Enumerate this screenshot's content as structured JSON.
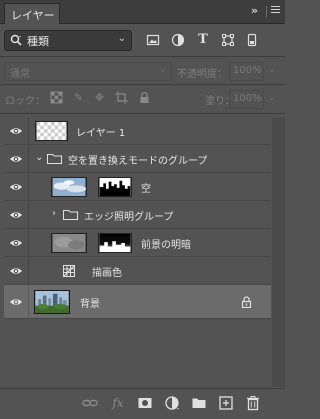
{
  "panel": {
    "tab_title": "レイヤー",
    "tab_close": "×",
    "collapse": "»"
  },
  "filter": {
    "kind_label": "種類",
    "icons": [
      "image-filter-icon",
      "adjustment-filter-icon",
      "type-filter-icon",
      "shape-filter-icon",
      "smart-object-filter-icon"
    ]
  },
  "blend": {
    "mode": "通常",
    "opacity_label": "不透明度：",
    "opacity_value": "100%"
  },
  "lock": {
    "label": "ロック：",
    "fill_label": "塗り：",
    "fill_value": "100%"
  },
  "layers": [
    {
      "name": "レイヤー 1",
      "type": "pixel",
      "visible": true,
      "selected": false
    },
    {
      "name": "空を置き換えモードのグループ",
      "type": "group",
      "expanded": true,
      "visible": true
    },
    {
      "name": "空",
      "type": "pixel-with-mask",
      "visible": true
    },
    {
      "name": "エッジ照明グループ",
      "type": "group",
      "expanded": false,
      "visible": true
    },
    {
      "name": "前景の明暗",
      "type": "pixel-with-mask",
      "visible": true
    },
    {
      "name": "描画色",
      "type": "adjustment",
      "visible": true
    },
    {
      "name": "背景",
      "type": "background",
      "visible": true,
      "selected": true,
      "locked": true
    }
  ],
  "footer": {
    "icons": [
      "link-layers-icon",
      "fx-icon",
      "add-mask-icon",
      "adjustment-layer-icon",
      "new-group-icon",
      "new-layer-icon",
      "trash-icon"
    ],
    "fx_label": "fx"
  }
}
